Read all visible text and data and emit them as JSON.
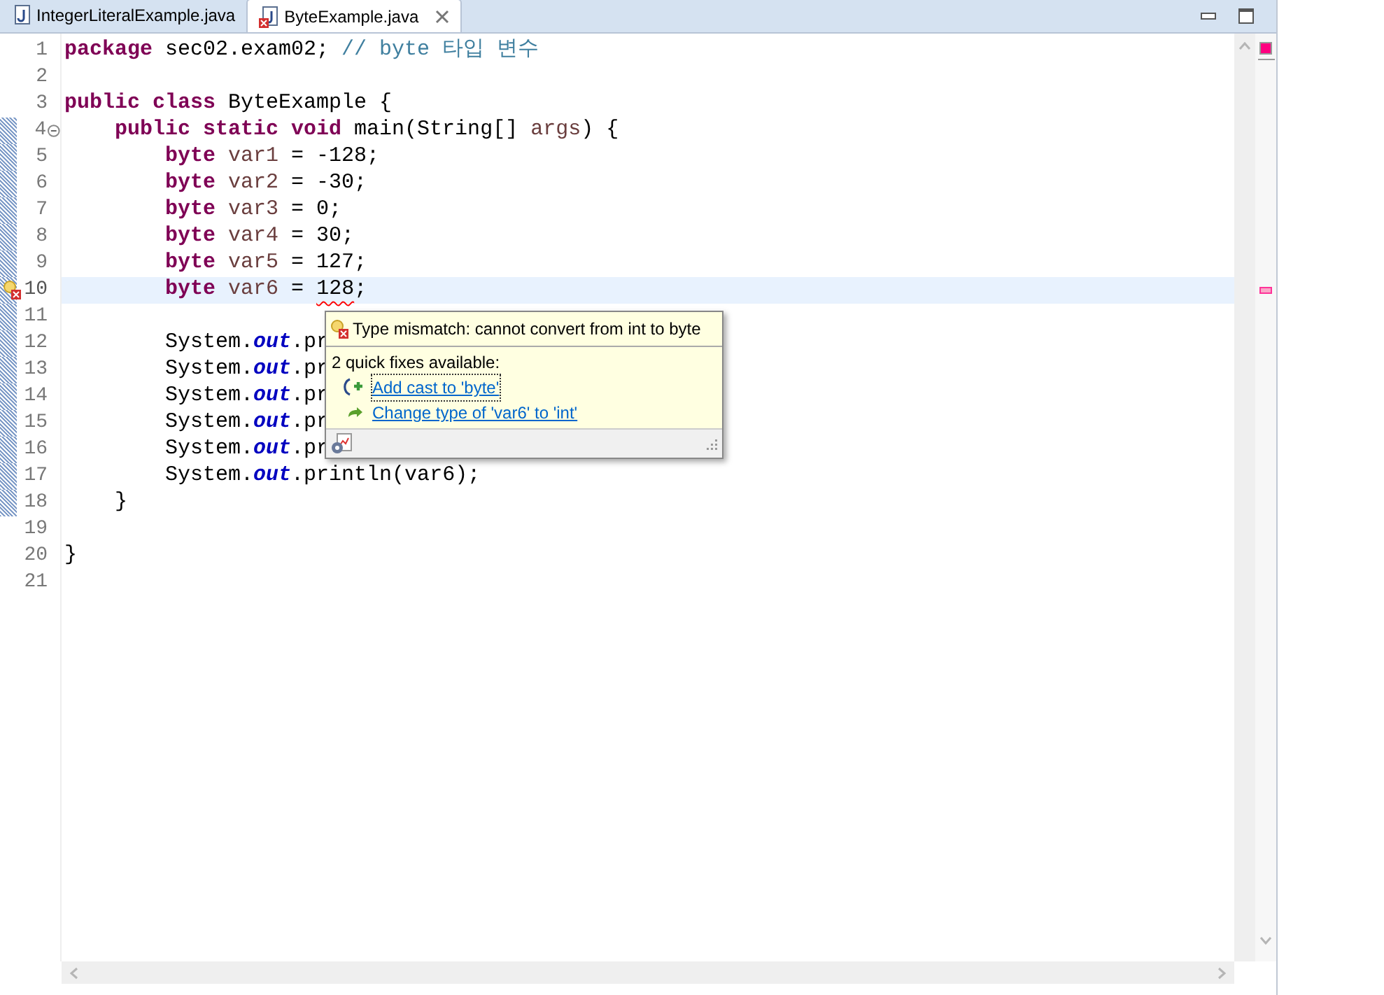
{
  "tabs": [
    {
      "label": "IntegerLiteralExample.java",
      "selected": false,
      "error": false
    },
    {
      "label": "ByteExample.java",
      "selected": true,
      "error": true
    }
  ],
  "editor": {
    "lines": [
      {
        "number": "1",
        "changed": false,
        "current": false,
        "error": false,
        "foldable": false,
        "tokens": [
          {
            "kind": "keyword",
            "text": "package"
          },
          {
            "kind": "plain",
            "text": " sec02.exam02; "
          },
          {
            "kind": "comment",
            "text": "// byte 타입 변수"
          }
        ]
      },
      {
        "number": "2",
        "changed": false,
        "current": false,
        "error": false,
        "foldable": false
      },
      {
        "number": "3",
        "changed": false,
        "current": false,
        "error": false,
        "foldable": false,
        "tokens": [
          {
            "kind": "keyword",
            "text": "public class"
          },
          {
            "kind": "plain",
            "text": " ByteExample {"
          }
        ]
      },
      {
        "number": "4",
        "changed": true,
        "current": false,
        "error": false,
        "foldable": true,
        "tokens": [
          {
            "kind": "keyword",
            "text": "    public static void"
          },
          {
            "kind": "plain",
            "text": " main(String[] "
          },
          {
            "kind": "local",
            "text": "args"
          },
          {
            "kind": "plain",
            "text": ") {"
          }
        ]
      },
      {
        "number": "5",
        "changed": true,
        "current": false,
        "error": false,
        "foldable": false,
        "tokens": [
          {
            "kind": "keyword",
            "text": "        byte"
          },
          {
            "kind": "local",
            "text": " var1"
          },
          {
            "kind": "plain",
            "text": " = -128;"
          }
        ]
      },
      {
        "number": "6",
        "changed": true,
        "current": false,
        "error": false,
        "foldable": false,
        "tokens": [
          {
            "kind": "keyword",
            "text": "        byte"
          },
          {
            "kind": "local",
            "text": " var2"
          },
          {
            "kind": "plain",
            "text": " = -30;"
          }
        ]
      },
      {
        "number": "7",
        "changed": true,
        "current": false,
        "error": false,
        "foldable": false,
        "tokens": [
          {
            "kind": "keyword",
            "text": "        byte"
          },
          {
            "kind": "local",
            "text": " var3"
          },
          {
            "kind": "plain",
            "text": " = 0;"
          }
        ]
      },
      {
        "number": "8",
        "changed": true,
        "current": false,
        "error": false,
        "foldable": false,
        "tokens": [
          {
            "kind": "keyword",
            "text": "        byte"
          },
          {
            "kind": "local",
            "text": " var4"
          },
          {
            "kind": "plain",
            "text": " = 30;"
          }
        ]
      },
      {
        "number": "9",
        "changed": true,
        "current": false,
        "error": false,
        "foldable": false,
        "tokens": [
          {
            "kind": "keyword",
            "text": "        byte"
          },
          {
            "kind": "local",
            "text": " var5"
          },
          {
            "kind": "plain",
            "text": " = 127;"
          }
        ]
      },
      {
        "number": "10",
        "changed": true,
        "current": true,
        "error": true,
        "foldable": false,
        "tokens": [
          {
            "kind": "keyword",
            "text": "        byte"
          },
          {
            "kind": "local",
            "text": " var6"
          },
          {
            "kind": "plain",
            "text": " = "
          },
          {
            "kind": "error",
            "text": "128"
          },
          {
            "kind": "plain",
            "text": ";"
          }
        ]
      },
      {
        "number": "11",
        "changed": true,
        "current": false,
        "error": false,
        "foldable": false
      },
      {
        "number": "12",
        "changed": true,
        "current": false,
        "error": false,
        "foldable": false,
        "tokens": [
          {
            "kind": "plain",
            "text": "        System."
          },
          {
            "kind": "field",
            "text": "out"
          },
          {
            "kind": "plain",
            "text": ".pr"
          }
        ]
      },
      {
        "number": "13",
        "changed": true,
        "current": false,
        "error": false,
        "foldable": false,
        "tokens": [
          {
            "kind": "plain",
            "text": "        System."
          },
          {
            "kind": "field",
            "text": "out"
          },
          {
            "kind": "plain",
            "text": ".pr"
          }
        ]
      },
      {
        "number": "14",
        "changed": true,
        "current": false,
        "error": false,
        "foldable": false,
        "tokens": [
          {
            "kind": "plain",
            "text": "        System."
          },
          {
            "kind": "field",
            "text": "out"
          },
          {
            "kind": "plain",
            "text": ".pr"
          }
        ]
      },
      {
        "number": "15",
        "changed": true,
        "current": false,
        "error": false,
        "foldable": false,
        "tokens": [
          {
            "kind": "plain",
            "text": "        System."
          },
          {
            "kind": "field",
            "text": "out"
          },
          {
            "kind": "plain",
            "text": ".pr"
          }
        ]
      },
      {
        "number": "16",
        "changed": true,
        "current": false,
        "error": false,
        "foldable": false,
        "tokens": [
          {
            "kind": "plain",
            "text": "        System."
          },
          {
            "kind": "field",
            "text": "out"
          },
          {
            "kind": "plain",
            "text": ".pr"
          }
        ]
      },
      {
        "number": "17",
        "changed": true,
        "current": false,
        "error": false,
        "foldable": false,
        "tokens": [
          {
            "kind": "plain",
            "text": "        System."
          },
          {
            "kind": "field",
            "text": "out"
          },
          {
            "kind": "plain",
            "text": ".println(var6);"
          }
        ]
      },
      {
        "number": "18",
        "changed": true,
        "current": false,
        "error": false,
        "foldable": false,
        "tokens": [
          {
            "kind": "plain",
            "text": "    }"
          }
        ]
      },
      {
        "number": "19",
        "changed": false,
        "current": false,
        "error": false,
        "foldable": false
      },
      {
        "number": "20",
        "changed": false,
        "current": false,
        "error": false,
        "foldable": false,
        "tokens": [
          {
            "kind": "plain",
            "text": "}"
          }
        ]
      },
      {
        "number": "21",
        "changed": false,
        "current": false,
        "error": false,
        "foldable": false
      }
    ]
  },
  "popup": {
    "title": "Type mismatch: cannot convert from int to byte",
    "subtitle": "2 quick fixes available:",
    "fixes": [
      {
        "kind": "cast",
        "label": "Add cast to 'byte'",
        "focused": true
      },
      {
        "kind": "change",
        "label": "Change type of 'var6' to 'int'",
        "focused": false
      }
    ]
  }
}
